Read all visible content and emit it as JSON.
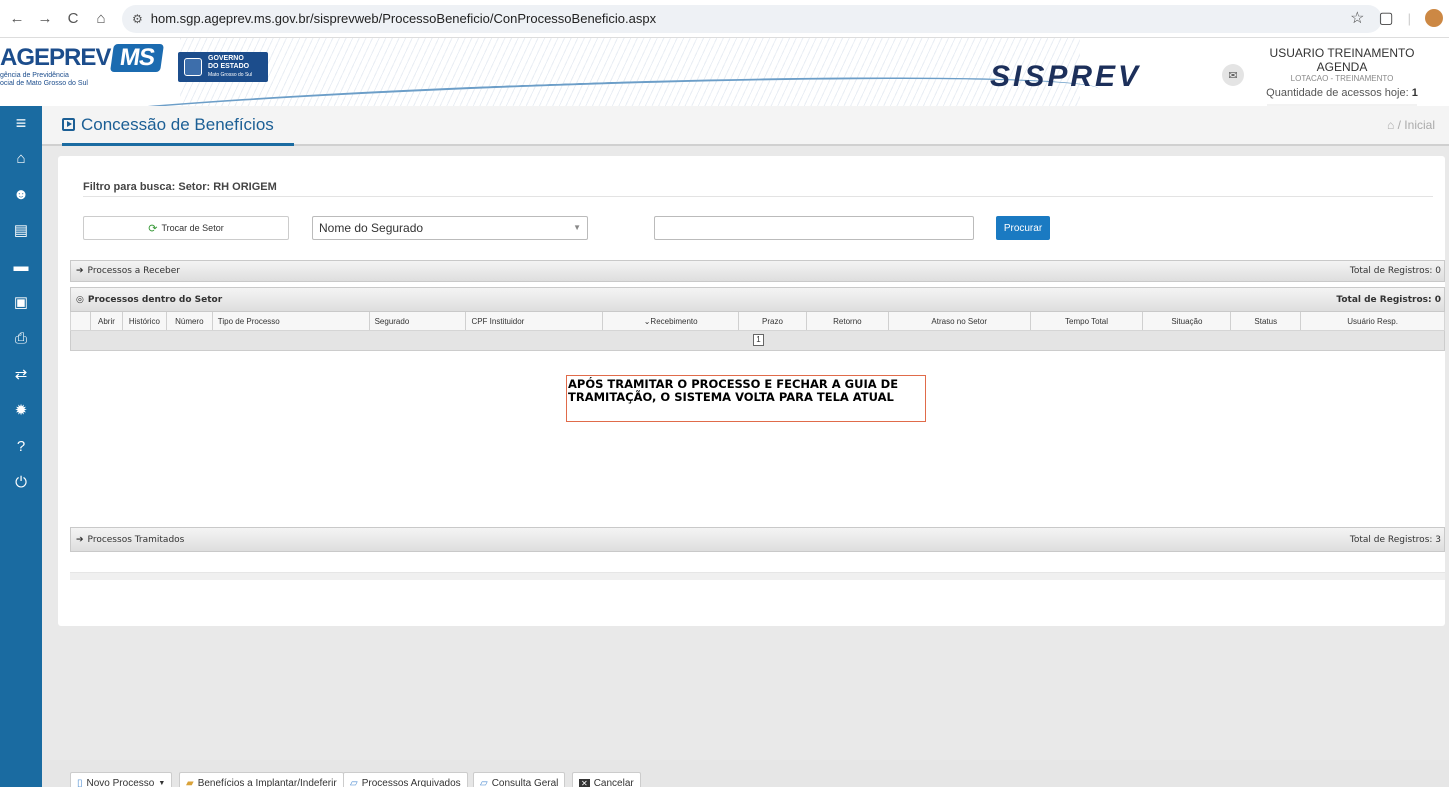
{
  "browser": {
    "back": "←",
    "forward": "→",
    "reload": "C",
    "home": "⌂",
    "url": "hom.sgp.ageprev.ms.gov.br/sisprevweb/ProcessoBeneficio/ConProcessoBeneficio.aspx",
    "star": "☆",
    "puzzle": "▢",
    "sep": "|"
  },
  "header": {
    "logo_main": "AGEPREV",
    "logo_ms": "MS",
    "logo_sub_1": "gência de Previdência",
    "logo_sub_2": "ocial de Mato Grosso do Sul",
    "gov_line_1": "GOVERNO",
    "gov_line_2": "DO ESTADO",
    "gov_line_3": "Mato Grosso do Sul",
    "brand": "SISPREV",
    "mail_icon": "✉",
    "user_name": "USUARIO TREINAMENTO AGENDA",
    "user_lotacao": "LOTACAO - TREINAMENTO",
    "access_label": "Quantidade de acessos hoje:",
    "access_count": "1"
  },
  "sidebar": {
    "items": [
      {
        "icon": "≡",
        "name": "menu-icon"
      },
      {
        "icon": "⌂",
        "name": "home-icon"
      },
      {
        "icon": "☻",
        "name": "users-icon"
      },
      {
        "icon": "▤",
        "name": "building-icon"
      },
      {
        "icon": "▬",
        "name": "archive-icon"
      },
      {
        "icon": "▣",
        "name": "money-icon"
      },
      {
        "icon": "⎙",
        "name": "print-icon"
      },
      {
        "icon": "⇄",
        "name": "exchange-icon"
      },
      {
        "icon": "✹",
        "name": "gear-icon"
      },
      {
        "icon": "?",
        "name": "help-icon"
      },
      {
        "icon": "⏻",
        "name": "power-icon"
      }
    ]
  },
  "page": {
    "title": "Concessão de Benefícios",
    "breadcrumb_home_icon": "⌂",
    "breadcrumb": "/ Inicial"
  },
  "filter": {
    "label": "Filtro para busca: Setor: RH ORIGEM",
    "trocar_label": "Trocar de Setor",
    "select_value": "Nome do Segurado",
    "search_value": "",
    "procurar_label": "Procurar"
  },
  "sections": {
    "receber": {
      "label": "Processos a Receber",
      "total": "Total de Registros: 0"
    },
    "dentro": {
      "label": "Processos dentro do Setor",
      "total": "Total de Registros: 0"
    },
    "tramitados": {
      "label": "Processos Tramitados",
      "total": "Total de Registros: 3"
    }
  },
  "table": {
    "columns": [
      "Abrir",
      "Histórico",
      "Número",
      "Tipo de Processo",
      "Segurado",
      "CPF Instituidor",
      "Recebimento",
      "Prazo",
      "Retorno",
      "Atraso no Setor",
      "Tempo Total",
      "Situação",
      "Status",
      "Usuário Resp."
    ],
    "sort_indicator": "⌄",
    "page": "1"
  },
  "annotation": {
    "line_1": "APÓS TRAMITAR O PROCESSO E FECHAR A GUIA DE",
    "line_2": "TRAMITAÇÃO, O SISTEMA VOLTA PARA TELA ATUAL"
  },
  "toolbar": {
    "novo_processo": "Novo Processo",
    "beneficios": "Benefícios a Implantar/Indeferir",
    "arquivados": "Processos Arquivados",
    "consulta": "Consulta Geral",
    "cancelar": "Cancelar"
  }
}
